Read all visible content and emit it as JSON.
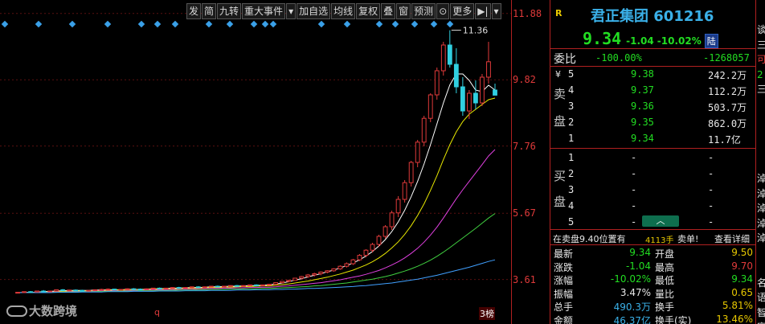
{
  "toolbar": [
    "发",
    "简",
    "九转",
    "重大事件",
    "▾",
    "加自选",
    "均线",
    "复权",
    "叠",
    "窗",
    "预测",
    "⊙",
    "更多",
    "▶|",
    "▾"
  ],
  "price_axis": [
    {
      "label": "11.88",
      "value": 11.88
    },
    {
      "label": "9.82",
      "value": 9.82
    },
    {
      "label": "7.76",
      "value": 7.76
    },
    {
      "label": "5.67",
      "value": 5.67
    },
    {
      "label": "3.61",
      "value": 3.61
    }
  ],
  "high_marker": "11.36",
  "watermark": "大数跨境",
  "bottom_marks": {
    "left1": "q",
    "right": "3榜"
  },
  "stock": {
    "tag": "R",
    "name": "君正集团 601216",
    "price": "9.34",
    "change": "-1.04",
    "pct": "-10.02%",
    "board": "陆"
  },
  "weibi": {
    "label": "委比",
    "pct": "-100.00%",
    "diff": "-1268057"
  },
  "sell": {
    "label": [
      "卖",
      "盘"
    ],
    "rows": [
      {
        "n": "5",
        "price": "9.38",
        "vol": "242.2万"
      },
      {
        "n": "4",
        "price": "9.37",
        "vol": "112.2万"
      },
      {
        "n": "3",
        "price": "9.36",
        "vol": "503.7万"
      },
      {
        "n": "2",
        "price": "9.35",
        "vol": "862.0万"
      },
      {
        "n": "1",
        "price": "9.34",
        "vol": "11.7亿"
      }
    ]
  },
  "buy": {
    "label": [
      "买",
      "盘"
    ],
    "rows": [
      {
        "n": "1",
        "price": "-",
        "vol": "-"
      },
      {
        "n": "2",
        "price": "-",
        "vol": "-"
      },
      {
        "n": "3",
        "price": "-",
        "vol": "-"
      },
      {
        "n": "4",
        "price": "-",
        "vol": "-"
      },
      {
        "n": "5",
        "price": "-",
        "vol": "-"
      }
    ]
  },
  "yen": "¥",
  "tradeinfo": {
    "text": "在卖盘9.40位置有",
    "qty": "4113手",
    "action": "卖单!",
    "detail": "查看详细"
  },
  "stats": [
    {
      "l1": "最新",
      "v1": "9.34",
      "l2": "开盘",
      "v2": "9.50"
    },
    {
      "l1": "涨跌",
      "v1": "-1.04",
      "l2": "最高",
      "v2": "9.70"
    },
    {
      "l1": "涨幅",
      "v1": "-10.02%",
      "l2": "最低",
      "v2": "9.34"
    },
    {
      "l1": "振幅",
      "v1": "3.47%",
      "l2": "量比",
      "v2": "0.65"
    },
    {
      "l1": "总手",
      "v1": "490.3万",
      "l2": "换手",
      "v2": "5.81%"
    },
    {
      "l1": "金额",
      "v1": "46.37亿",
      "l2": "换手(实)",
      "v2": "13.46%"
    }
  ],
  "strip": [
    "谈",
    "三",
    "可",
    "2",
    "三",
    "",
    "",
    "",
    "",
    "",
    "淖",
    "淖",
    "淖",
    "淖",
    "淖",
    "",
    "",
    "名",
    "语",
    "智",
    "富"
  ],
  "chart_data": {
    "type": "candlestick",
    "ylim": [
      3.0,
      12.0
    ],
    "candles": [
      [
        3.2,
        3.22,
        3.18,
        3.21
      ],
      [
        3.21,
        3.24,
        3.19,
        3.23
      ],
      [
        3.23,
        3.25,
        3.2,
        3.22
      ],
      [
        3.22,
        3.26,
        3.21,
        3.25
      ],
      [
        3.25,
        3.28,
        3.23,
        3.24
      ],
      [
        3.24,
        3.26,
        3.22,
        3.25
      ],
      [
        3.25,
        3.3,
        3.24,
        3.29
      ],
      [
        3.29,
        3.31,
        3.26,
        3.27
      ],
      [
        3.27,
        3.29,
        3.25,
        3.28
      ],
      [
        3.28,
        3.3,
        3.26,
        3.27
      ],
      [
        3.27,
        3.29,
        3.24,
        3.26
      ],
      [
        3.26,
        3.28,
        3.24,
        3.27
      ],
      [
        3.27,
        3.3,
        3.26,
        3.29
      ],
      [
        3.29,
        3.32,
        3.28,
        3.3
      ],
      [
        3.3,
        3.33,
        3.28,
        3.31
      ],
      [
        3.31,
        3.32,
        3.28,
        3.29
      ],
      [
        3.29,
        3.31,
        3.27,
        3.3
      ],
      [
        3.3,
        3.33,
        3.29,
        3.32
      ],
      [
        3.32,
        3.34,
        3.3,
        3.31
      ],
      [
        3.31,
        3.33,
        3.29,
        3.3
      ],
      [
        3.3,
        3.33,
        3.29,
        3.32
      ],
      [
        3.32,
        3.35,
        3.31,
        3.34
      ],
      [
        3.34,
        3.36,
        3.32,
        3.33
      ],
      [
        3.33,
        3.35,
        3.31,
        3.34
      ],
      [
        3.34,
        3.37,
        3.33,
        3.36
      ],
      [
        3.36,
        3.38,
        3.34,
        3.35
      ],
      [
        3.35,
        3.37,
        3.33,
        3.36
      ],
      [
        3.36,
        3.39,
        3.35,
        3.38
      ],
      [
        3.38,
        3.4,
        3.36,
        3.37
      ],
      [
        3.37,
        3.39,
        3.35,
        3.38
      ],
      [
        3.38,
        3.41,
        3.37,
        3.4
      ],
      [
        3.4,
        3.42,
        3.38,
        3.39
      ],
      [
        3.39,
        3.41,
        3.37,
        3.4
      ],
      [
        3.4,
        3.43,
        3.39,
        3.42
      ],
      [
        3.42,
        3.44,
        3.4,
        3.41
      ],
      [
        3.41,
        3.43,
        3.39,
        3.42
      ],
      [
        3.42,
        3.45,
        3.41,
        3.44
      ],
      [
        3.44,
        3.46,
        3.42,
        3.43
      ],
      [
        3.43,
        3.45,
        3.41,
        3.44
      ],
      [
        3.44,
        3.47,
        3.43,
        3.46
      ],
      [
        3.46,
        3.52,
        3.45,
        3.51
      ],
      [
        3.51,
        3.56,
        3.49,
        3.55
      ],
      [
        3.55,
        3.6,
        3.52,
        3.58
      ],
      [
        3.58,
        3.66,
        3.57,
        3.65
      ],
      [
        3.65,
        3.72,
        3.62,
        3.7
      ],
      [
        3.7,
        3.78,
        3.66,
        3.75
      ],
      [
        3.75,
        3.82,
        3.7,
        3.79
      ],
      [
        3.79,
        3.86,
        3.74,
        3.84
      ],
      [
        3.84,
        3.9,
        3.8,
        3.88
      ],
      [
        3.88,
        3.96,
        3.85,
        3.94
      ],
      [
        3.94,
        4.05,
        3.91,
        4.02
      ],
      [
        4.02,
        4.14,
        3.98,
        4.1
      ],
      [
        4.1,
        4.25,
        4.06,
        4.22
      ],
      [
        4.22,
        4.4,
        4.18,
        4.36
      ],
      [
        4.36,
        4.55,
        4.3,
        4.52
      ],
      [
        4.52,
        4.75,
        4.45,
        4.7
      ],
      [
        4.7,
        5.0,
        4.62,
        4.95
      ],
      [
        4.95,
        5.3,
        4.88,
        5.25
      ],
      [
        5.25,
        5.75,
        5.15,
        5.68
      ],
      [
        5.68,
        6.2,
        5.55,
        6.1
      ],
      [
        6.1,
        6.7,
        6.0,
        6.62
      ],
      [
        6.62,
        7.3,
        6.5,
        7.25
      ],
      [
        7.25,
        7.95,
        7.1,
        7.88
      ],
      [
        7.88,
        8.7,
        7.75,
        8.62
      ],
      [
        8.62,
        9.4,
        8.5,
        9.35
      ],
      [
        9.35,
        10.2,
        9.2,
        10.1
      ],
      [
        10.1,
        11.0,
        9.95,
        10.9
      ],
      [
        10.9,
        11.36,
        10.2,
        10.3
      ],
      [
        10.3,
        10.8,
        9.4,
        9.6
      ],
      [
        9.6,
        9.9,
        8.7,
        8.85
      ],
      [
        8.85,
        9.5,
        8.6,
        9.4
      ],
      [
        9.4,
        9.8,
        8.9,
        9.1
      ],
      [
        9.1,
        10.0,
        9.0,
        9.9
      ],
      [
        9.9,
        11.0,
        9.7,
        10.38
      ],
      [
        9.5,
        9.7,
        9.34,
        9.34
      ]
    ],
    "ma": [
      {
        "color": "#ffffff",
        "values": [
          3.2,
          3.21,
          3.21,
          3.22,
          3.23,
          3.24,
          3.25,
          3.26,
          3.27,
          3.27,
          3.27,
          3.27,
          3.28,
          3.28,
          3.29,
          3.29,
          3.29,
          3.3,
          3.3,
          3.3,
          3.31,
          3.32,
          3.32,
          3.33,
          3.34,
          3.34,
          3.35,
          3.36,
          3.36,
          3.37,
          3.38,
          3.38,
          3.39,
          3.4,
          3.4,
          3.41,
          3.42,
          3.42,
          3.43,
          3.44,
          3.47,
          3.5,
          3.54,
          3.59,
          3.63,
          3.69,
          3.74,
          3.79,
          3.85,
          3.9,
          3.97,
          4.04,
          4.12,
          4.22,
          4.34,
          4.48,
          4.65,
          4.85,
          5.1,
          5.4,
          5.76,
          6.18,
          6.66,
          7.2,
          7.8,
          8.45,
          9.1,
          9.66,
          10.0,
          10.0,
          9.8,
          9.5,
          9.45,
          9.65,
          9.5
        ]
      },
      {
        "color": "#e8e800",
        "values": [
          3.2,
          3.2,
          3.21,
          3.21,
          3.22,
          3.22,
          3.23,
          3.24,
          3.24,
          3.25,
          3.25,
          3.26,
          3.26,
          3.27,
          3.27,
          3.28,
          3.28,
          3.29,
          3.29,
          3.3,
          3.3,
          3.31,
          3.31,
          3.32,
          3.32,
          3.33,
          3.33,
          3.34,
          3.34,
          3.35,
          3.36,
          3.36,
          3.37,
          3.37,
          3.38,
          3.39,
          3.39,
          3.4,
          3.41,
          3.41,
          3.43,
          3.45,
          3.47,
          3.5,
          3.53,
          3.56,
          3.6,
          3.64,
          3.68,
          3.73,
          3.78,
          3.84,
          3.9,
          3.98,
          4.06,
          4.16,
          4.28,
          4.42,
          4.59,
          4.78,
          5.01,
          5.28,
          5.6,
          5.96,
          6.38,
          6.84,
          7.34,
          7.8,
          8.2,
          8.52,
          8.75,
          8.9,
          9.05,
          9.2,
          9.25
        ]
      },
      {
        "color": "#e040e0",
        "values": [
          3.2,
          3.2,
          3.2,
          3.21,
          3.21,
          3.22,
          3.22,
          3.22,
          3.23,
          3.23,
          3.24,
          3.24,
          3.25,
          3.25,
          3.25,
          3.26,
          3.26,
          3.27,
          3.27,
          3.28,
          3.28,
          3.28,
          3.29,
          3.29,
          3.3,
          3.3,
          3.31,
          3.31,
          3.32,
          3.32,
          3.33,
          3.33,
          3.34,
          3.34,
          3.35,
          3.35,
          3.36,
          3.36,
          3.37,
          3.37,
          3.38,
          3.4,
          3.41,
          3.43,
          3.45,
          3.47,
          3.49,
          3.51,
          3.54,
          3.57,
          3.6,
          3.64,
          3.68,
          3.72,
          3.77,
          3.83,
          3.89,
          3.97,
          4.06,
          4.16,
          4.28,
          4.42,
          4.58,
          4.77,
          4.99,
          5.24,
          5.52,
          5.82,
          6.12,
          6.4,
          6.66,
          6.92,
          7.18,
          7.45,
          7.65
        ]
      },
      {
        "color": "#40d040",
        "values": [
          3.2,
          3.2,
          3.2,
          3.2,
          3.21,
          3.21,
          3.21,
          3.22,
          3.22,
          3.22,
          3.23,
          3.23,
          3.23,
          3.24,
          3.24,
          3.24,
          3.25,
          3.25,
          3.25,
          3.26,
          3.26,
          3.26,
          3.27,
          3.27,
          3.27,
          3.28,
          3.28,
          3.28,
          3.29,
          3.29,
          3.3,
          3.3,
          3.3,
          3.31,
          3.31,
          3.32,
          3.32,
          3.32,
          3.33,
          3.33,
          3.34,
          3.35,
          3.36,
          3.37,
          3.38,
          3.39,
          3.41,
          3.42,
          3.44,
          3.46,
          3.48,
          3.5,
          3.53,
          3.56,
          3.59,
          3.62,
          3.66,
          3.7,
          3.75,
          3.81,
          3.87,
          3.94,
          4.02,
          4.11,
          4.21,
          4.33,
          4.46,
          4.6,
          4.75,
          4.9,
          5.05,
          5.2,
          5.36,
          5.52,
          5.66
        ]
      },
      {
        "color": "#40a0ff",
        "values": [
          3.2,
          3.2,
          3.2,
          3.2,
          3.2,
          3.2,
          3.21,
          3.21,
          3.21,
          3.21,
          3.22,
          3.22,
          3.22,
          3.22,
          3.23,
          3.23,
          3.23,
          3.23,
          3.24,
          3.24,
          3.24,
          3.24,
          3.25,
          3.25,
          3.25,
          3.25,
          3.26,
          3.26,
          3.26,
          3.26,
          3.27,
          3.27,
          3.27,
          3.27,
          3.28,
          3.28,
          3.28,
          3.29,
          3.29,
          3.29,
          3.3,
          3.3,
          3.31,
          3.31,
          3.32,
          3.33,
          3.33,
          3.34,
          3.35,
          3.36,
          3.37,
          3.38,
          3.39,
          3.41,
          3.42,
          3.44,
          3.46,
          3.48,
          3.5,
          3.53,
          3.56,
          3.59,
          3.62,
          3.66,
          3.7,
          3.74,
          3.79,
          3.84,
          3.89,
          3.94,
          3.99,
          4.05,
          4.11,
          4.17,
          4.22
        ]
      }
    ]
  }
}
